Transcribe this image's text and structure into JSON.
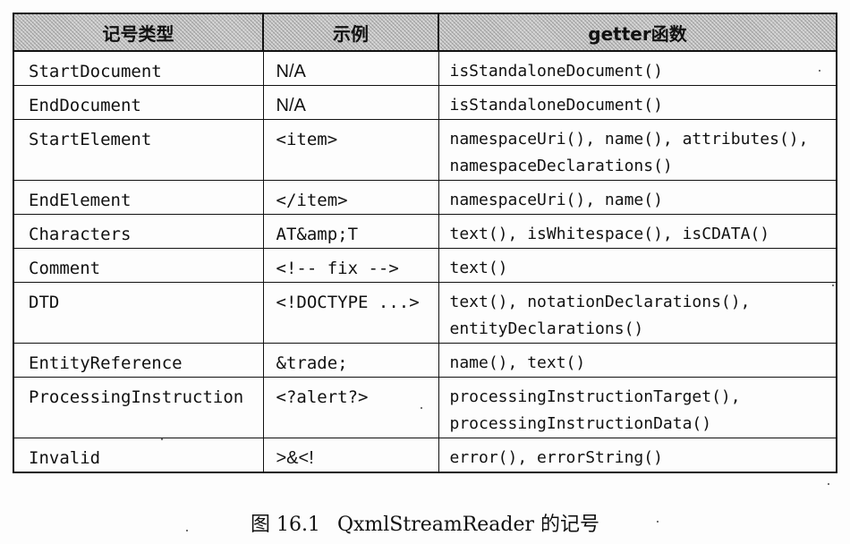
{
  "table": {
    "headers": [
      "记号类型",
      "示例",
      "getter函数"
    ],
    "rows": [
      {
        "type": "StartDocument",
        "example": "N/A",
        "getters": [
          "isStandaloneDocument()"
        ]
      },
      {
        "type": "EndDocument",
        "example": "N/A",
        "getters": [
          "isStandaloneDocument()"
        ]
      },
      {
        "type": "StartElement",
        "example": "<item>",
        "getters": [
          "namespaceUri(), name(), attributes(),",
          "namespaceDeclarations()"
        ]
      },
      {
        "type": "EndElement",
        "example": "</item>",
        "getters": [
          "namespaceUri(), name()"
        ]
      },
      {
        "type": "Characters",
        "example": "AT&amp;T",
        "getters": [
          "text(), isWhitespace(), isCDATA()"
        ]
      },
      {
        "type": "Comment",
        "example": "<!-- fix -->",
        "getters": [
          "text()"
        ]
      },
      {
        "type": "DTD",
        "example": "<!DOCTYPE ...>",
        "getters": [
          "text(), notationDeclarations(),",
          "entityDeclarations()"
        ]
      },
      {
        "type": "EntityReference",
        "example": "&trade;",
        "getters": [
          "name(), text()"
        ]
      },
      {
        "type": "ProcessingInstruction",
        "example": "<?alert?>",
        "getters": [
          "processingInstructionTarget(),",
          "processingInstructionData()"
        ]
      },
      {
        "type": "Invalid",
        "example": ">&<!",
        "getters": [
          "error(), errorString()"
        ]
      }
    ]
  },
  "caption": {
    "figure_label": "图 16.1",
    "text": "QxmlStreamReader 的记号"
  }
}
